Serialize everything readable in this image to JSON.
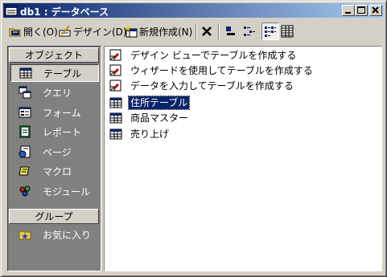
{
  "window": {
    "title": "db1 : データベース",
    "icons": {
      "app": "database-window-icon",
      "minimize": "minimize-icon",
      "maximize": "maximize-icon",
      "close": "close-icon"
    }
  },
  "toolbar": {
    "open_label": "開く(O)",
    "design_label": "デザイン(D)",
    "new_label": "新規作成(N)",
    "view_modes": [
      "large-icons",
      "small-icons",
      "list",
      "details"
    ],
    "active_view": "list"
  },
  "sidebar": {
    "objects_header": "オブジェクト",
    "items": [
      {
        "label": "テーブル",
        "icon": "table-icon",
        "selected": true
      },
      {
        "label": "クエリ",
        "icon": "query-icon"
      },
      {
        "label": "フォーム",
        "icon": "form-icon"
      },
      {
        "label": "レポート",
        "icon": "report-icon"
      },
      {
        "label": "ページ",
        "icon": "page-icon"
      },
      {
        "label": "マクロ",
        "icon": "macro-icon"
      },
      {
        "label": "モジュール",
        "icon": "module-icon"
      }
    ],
    "groups_header": "グループ",
    "group_items": [
      {
        "label": "お気に入り",
        "icon": "favorites-folder-icon"
      }
    ]
  },
  "list": {
    "items": [
      {
        "label": "デザイン ビューでテーブルを作成する",
        "icon": "create-shortcut-icon"
      },
      {
        "label": "ウィザードを使用してテーブルを作成する",
        "icon": "create-shortcut-icon"
      },
      {
        "label": "データを入力してテーブルを作成する",
        "icon": "create-shortcut-icon"
      },
      {
        "label": "住所テーブル",
        "icon": "table-icon",
        "selected": true
      },
      {
        "label": "商品マスター",
        "icon": "table-icon"
      },
      {
        "label": "売り上げ",
        "icon": "table-icon"
      }
    ]
  },
  "colors": {
    "title_start": "#0a246a",
    "title_end": "#a6caf0",
    "face": "#d4d0c8",
    "panel_dark": "#808080",
    "selection": "#0a246a"
  }
}
